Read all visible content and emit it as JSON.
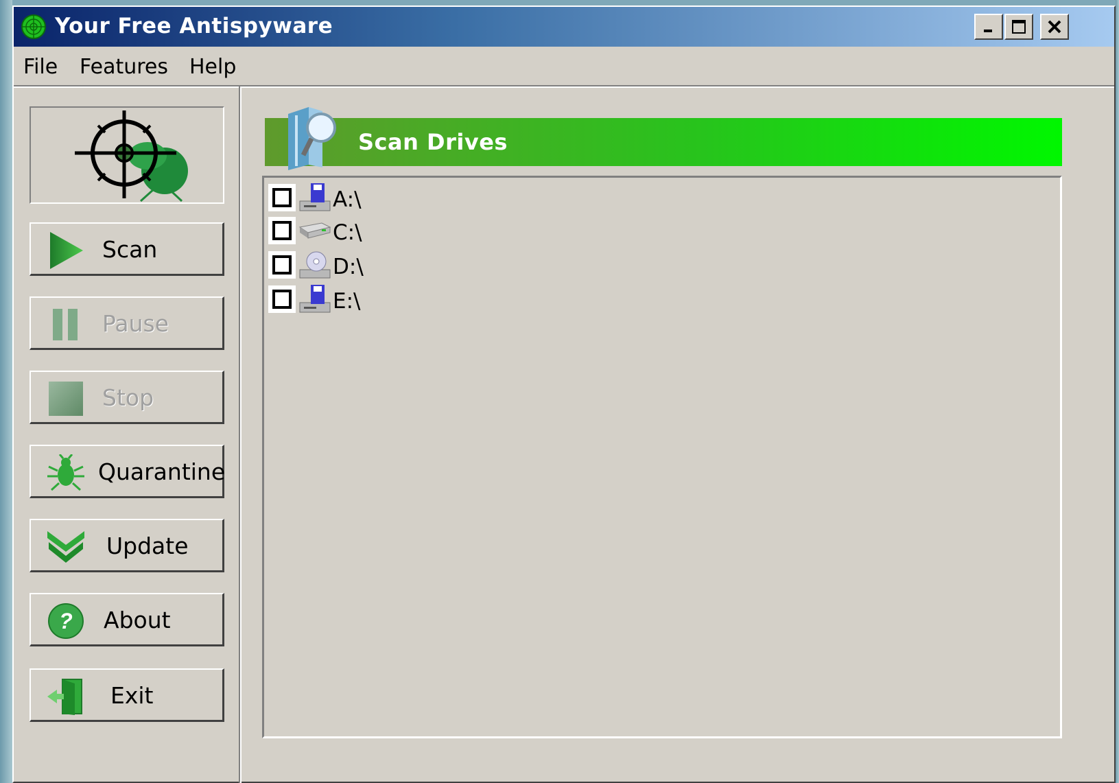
{
  "window": {
    "title": "Your Free Antispyware"
  },
  "menu": {
    "items": [
      "File",
      "Features",
      "Help"
    ]
  },
  "sidebar": {
    "buttons": [
      {
        "label": "Scan",
        "enabled": true,
        "icon": "play-icon"
      },
      {
        "label": "Pause",
        "enabled": false,
        "icon": "pause-icon"
      },
      {
        "label": "Stop",
        "enabled": false,
        "icon": "stop-icon"
      },
      {
        "label": "Quarantine",
        "enabled": true,
        "icon": "bug-icon"
      },
      {
        "label": "Update",
        "enabled": true,
        "icon": "chevron-down-icon"
      },
      {
        "label": "About",
        "enabled": true,
        "icon": "help-icon"
      },
      {
        "label": "Exit",
        "enabled": true,
        "icon": "exit-door-icon"
      }
    ]
  },
  "panel": {
    "header": "Scan Drives",
    "drives": [
      {
        "label": "A:\\",
        "checked": false,
        "icon": "floppy-drive-icon"
      },
      {
        "label": "C:\\",
        "checked": false,
        "icon": "hard-drive-icon"
      },
      {
        "label": "D:\\",
        "checked": false,
        "icon": "cd-drive-icon"
      },
      {
        "label": "E:\\",
        "checked": false,
        "icon": "floppy-drive-icon"
      }
    ]
  },
  "colors": {
    "accent_green": "#27c41c",
    "title_blue": "#0a246a",
    "face": "#d4d0c8"
  }
}
